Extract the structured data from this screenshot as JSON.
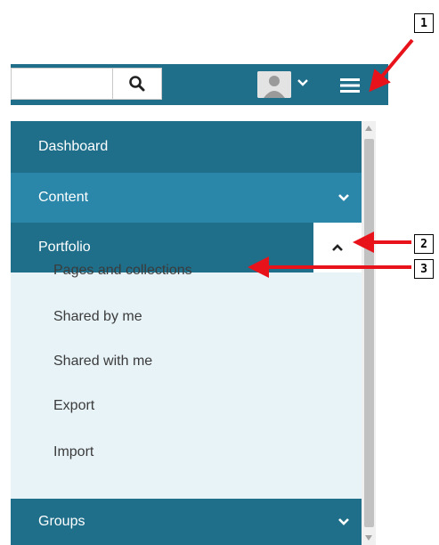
{
  "header": {
    "search_placeholder": "",
    "search_icon": "search-icon",
    "avatar_icon": "user-avatar-icon",
    "avatar_chevron_icon": "chevron-down-icon",
    "menu_icon": "hamburger-menu-icon"
  },
  "menu": {
    "items": [
      {
        "label": "Dashboard"
      },
      {
        "label": "Content",
        "icon": "chevron-down-icon"
      },
      {
        "label": "Portfolio",
        "icon": "chevron-up-icon",
        "expanded": true
      },
      {
        "label": "Groups",
        "icon": "chevron-down-icon"
      }
    ],
    "portfolio_subitems": [
      {
        "label": "Pages and collections"
      },
      {
        "label": "Shared by me"
      },
      {
        "label": "Shared with me"
      },
      {
        "label": "Export"
      },
      {
        "label": "Import"
      }
    ]
  },
  "callouts": [
    {
      "label": "1"
    },
    {
      "label": "2"
    },
    {
      "label": "3"
    }
  ],
  "colors": {
    "menu_dark": "#1f6f8b",
    "menu_light": "#2a87aa",
    "submenu_bg": "#e8f3f8",
    "annotation_arrow": "#e8121b"
  }
}
